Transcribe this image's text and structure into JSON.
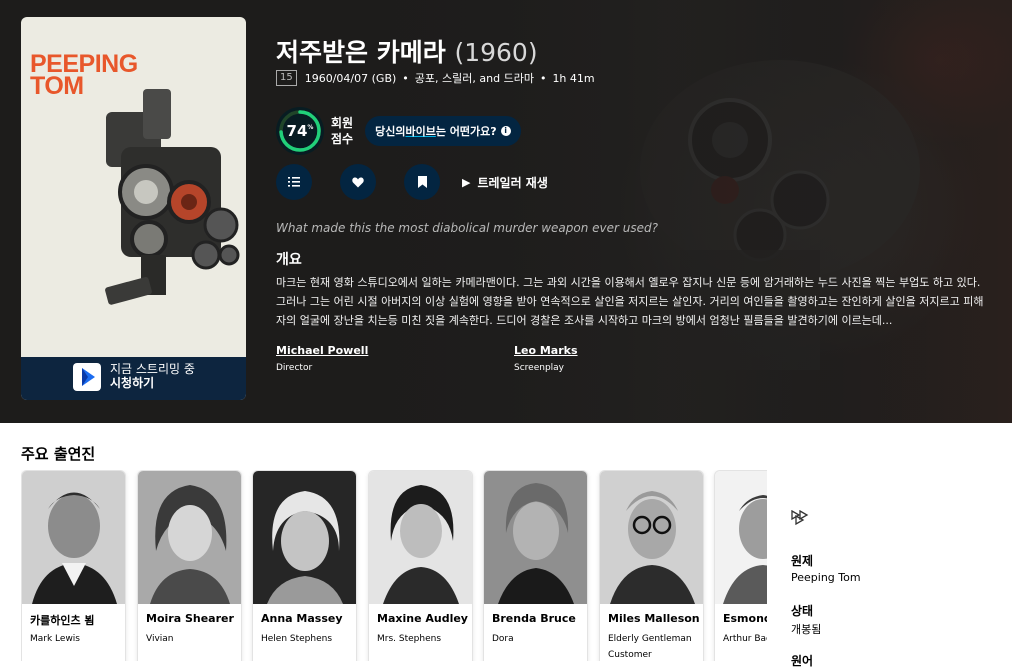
{
  "movie": {
    "title": "저주받은 카메라",
    "year": "(1960)",
    "certification": "15",
    "release": "1960/04/07 (GB)",
    "genres": "공포, 스릴러, and 드라마",
    "runtime": "1h 41m",
    "score": "74",
    "score_percent_symbol": "%",
    "score_value": 0.74,
    "score_label_line1": "회원",
    "score_label_line2": "점수",
    "vibe_prefix": "당신의 ",
    "vibe_link": "바이브",
    "vibe_suffix": "는 어떤가요?",
    "trailer_label": "트레일러 재생",
    "tagline": "What made this the most diabolical murder weapon ever used?",
    "overview_heading": "개요",
    "overview": "마크는 현재 영화 스튜디오에서 일하는 카메라맨이다. 그는 과외 시간을 이용해서 옐로우 잡지나 신문 등에 암거래하는 누드 사진을 찍는 부업도 하고 있다. 그러나 그는 어린 시절 아버지의 이상 실험에 영향을 받아 연속적으로 살인을 저지르는 살인자. 거리의 여인들을 촬영하고는 잔인하게 살인을 저지르고 피해자의 얼굴에 장난을 치는등 미친 짓을 계속한다. 드디어 경찰은 조사를 시작하고 마크의 방에서 엄청난 필름들을 발견하기에 이르는데..."
  },
  "poster": {
    "title_line1": "PEEPING",
    "title_line2": "TOM",
    "watch_line1": "지금 스트리밍 중",
    "watch_line2": "시청하기"
  },
  "crew": [
    {
      "name": "Michael Powell",
      "job": "Director"
    },
    {
      "name": "Leo Marks",
      "job": "Screenplay"
    }
  ],
  "cast_heading": "주요 출연진",
  "cast": [
    {
      "name": "카를하인츠 뵘",
      "role": "Mark Lewis"
    },
    {
      "name": "Moira Shearer",
      "role": "Vivian"
    },
    {
      "name": "Anna Massey",
      "role": "Helen Stephens"
    },
    {
      "name": "Maxine Audley",
      "role": "Mrs. Stephens"
    },
    {
      "name": "Brenda Bruce",
      "role": "Dora"
    },
    {
      "name": "Miles Malleson",
      "role": "Elderly Gentleman Customer"
    },
    {
      "name": "Esmond Knight",
      "role": "Arthur Baden"
    }
  ],
  "sidebar": {
    "original_title_label": "원제",
    "original_title_value": "Peeping Tom",
    "status_label": "상태",
    "status_value": "개봉됨",
    "language_label": "원어"
  },
  "colors": {
    "score_ring": "#21d07a",
    "score_track": "#204529",
    "accent_blue": "#01b4e4",
    "navy": "#032541",
    "poster_title": "#e8572b"
  }
}
